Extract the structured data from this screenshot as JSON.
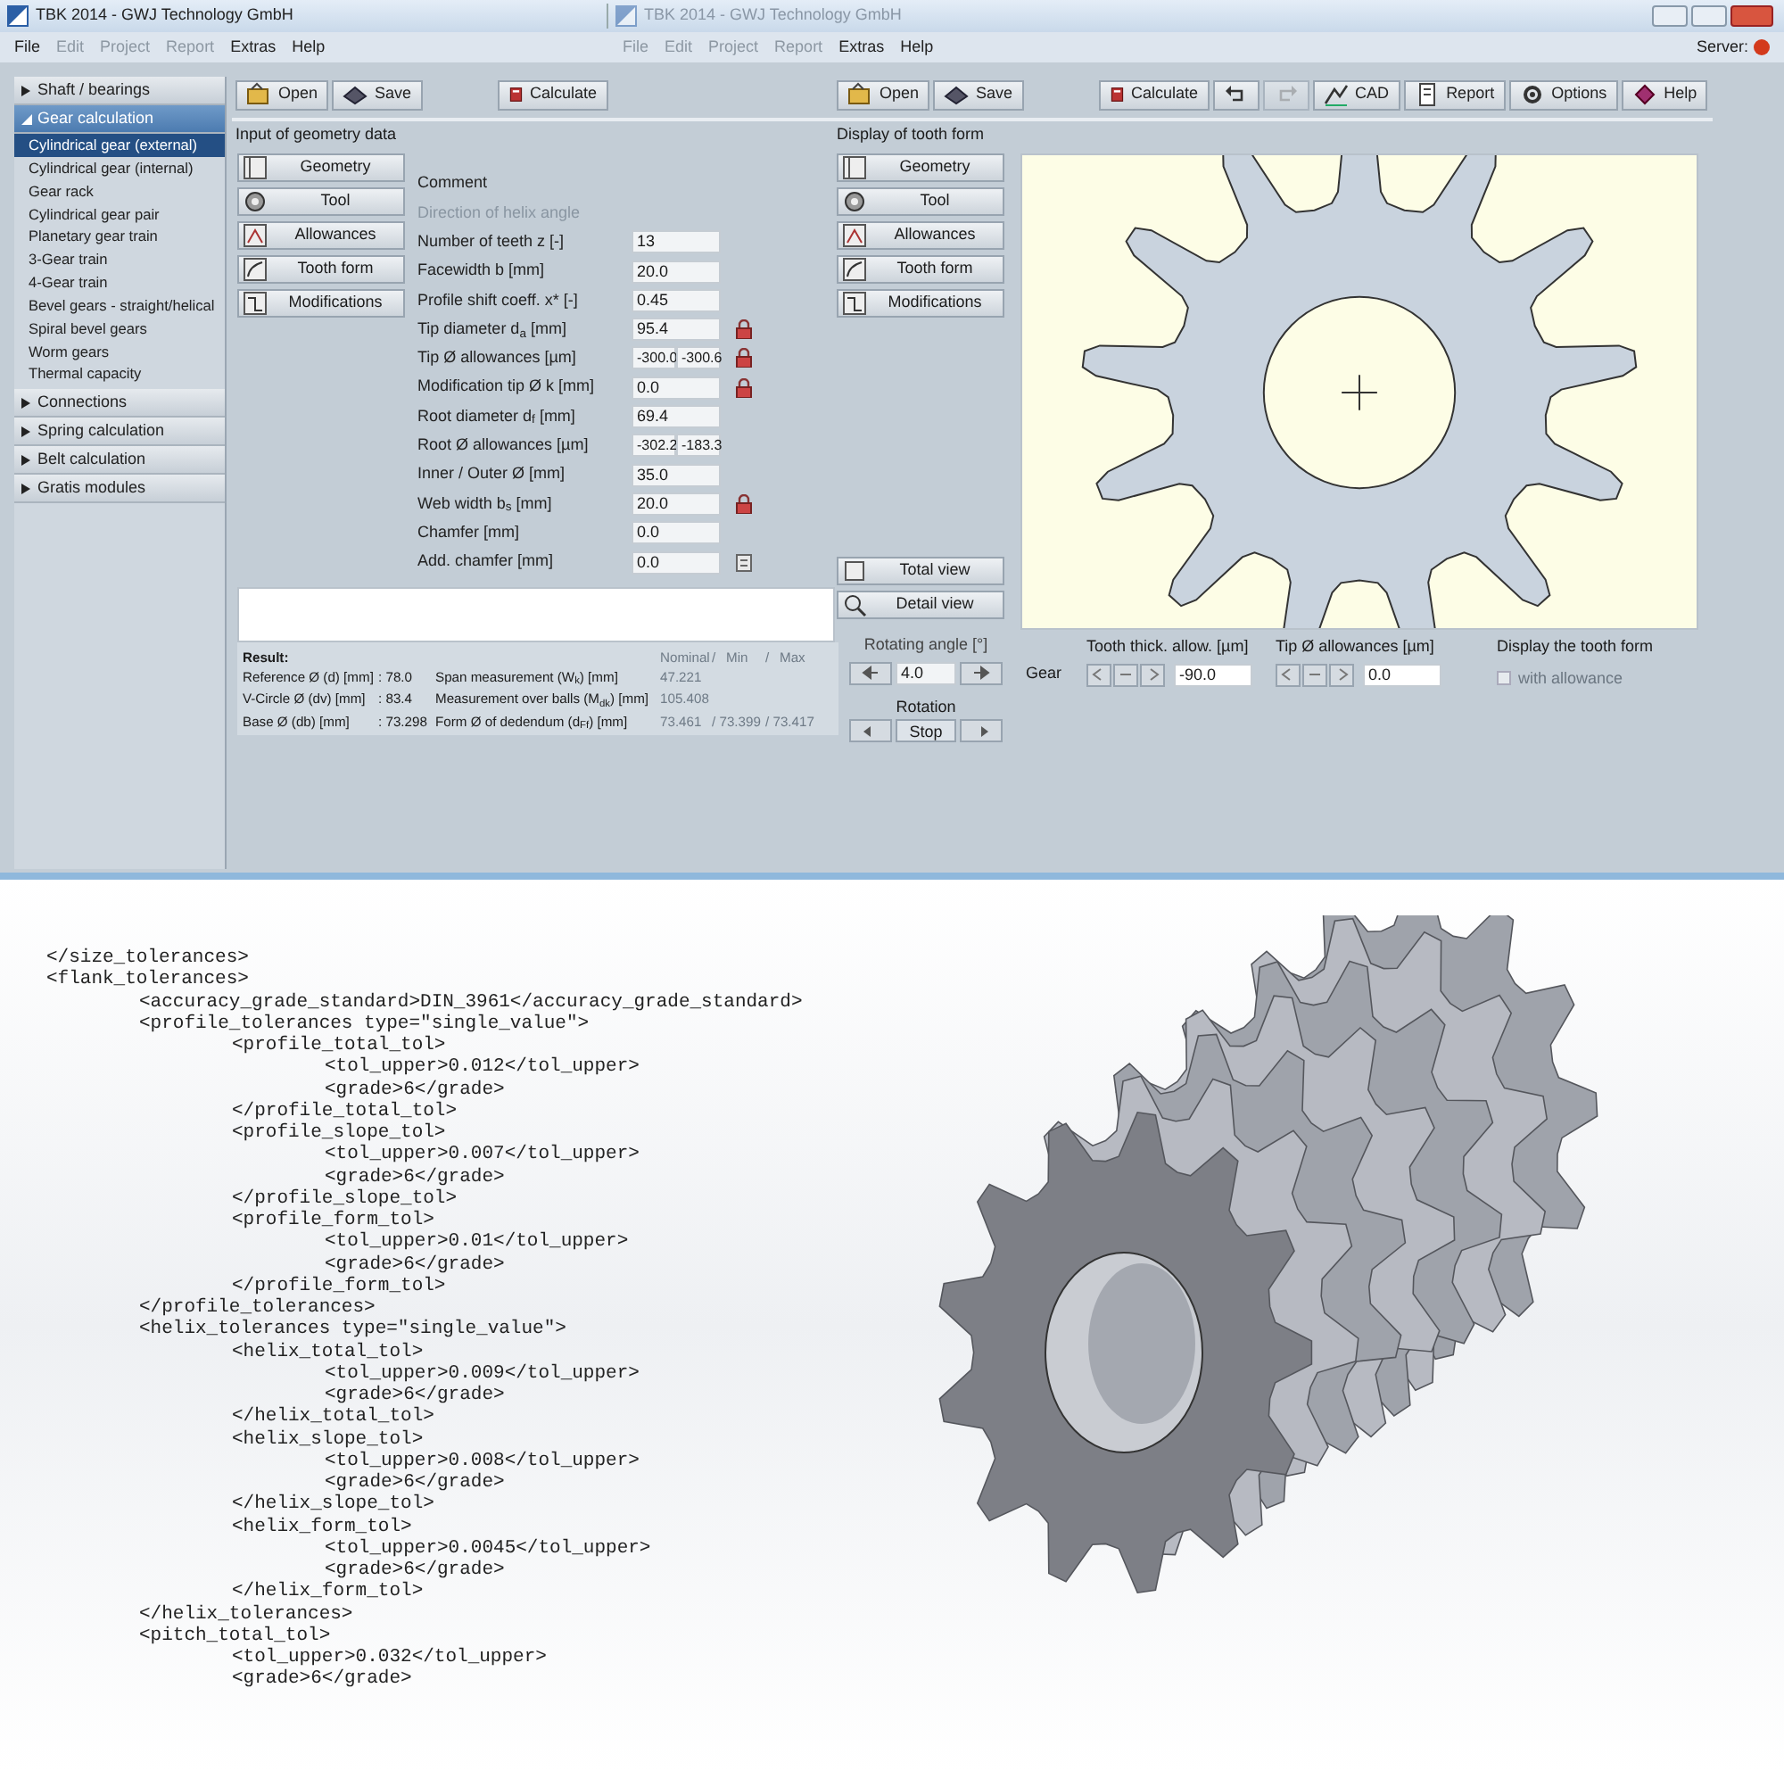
{
  "windows": [
    {
      "title": "TBK 2014 - GWJ Technology GmbH",
      "faded": false
    },
    {
      "title": "TBK 2014 - GWJ Technology GmbH",
      "faded": true
    }
  ],
  "menus": [
    [
      {
        "label": "File",
        "disabled": false
      },
      {
        "label": "Edit",
        "disabled": true
      },
      {
        "label": "Project",
        "disabled": true
      },
      {
        "label": "Report",
        "disabled": true
      },
      {
        "label": "Extras",
        "disabled": false
      },
      {
        "label": "Help",
        "disabled": false
      }
    ],
    [
      {
        "label": "File",
        "disabled": true
      },
      {
        "label": "Edit",
        "disabled": true
      },
      {
        "label": "Project",
        "disabled": true
      },
      {
        "label": "Report",
        "disabled": true
      },
      {
        "label": "Extras",
        "disabled": false
      },
      {
        "label": "Help",
        "disabled": false
      }
    ]
  ],
  "server": {
    "label": "Server:",
    "color": "#d33a1c"
  },
  "sidebar": [
    {
      "label": "Shaft / bearings",
      "expanded": false,
      "selected": false
    },
    {
      "label": "Gear calculation",
      "expanded": true,
      "selected": true,
      "children": [
        {
          "label": "Cylindrical gear (external)",
          "selected": true
        },
        {
          "label": "Cylindrical gear (internal)",
          "selected": false
        },
        {
          "label": "Gear rack",
          "selected": false
        },
        {
          "label": "Cylindrical gear pair",
          "selected": false
        },
        {
          "label": "Planetary gear train",
          "selected": false
        },
        {
          "label": "3-Gear train",
          "selected": false
        },
        {
          "label": "4-Gear train",
          "selected": false
        },
        {
          "label": "Bevel gears - straight/helical",
          "selected": false
        },
        {
          "label": "Spiral bevel gears",
          "selected": false
        },
        {
          "label": "Worm gears",
          "selected": false
        },
        {
          "label": "Thermal capacity",
          "selected": false
        }
      ]
    },
    {
      "label": "Connections",
      "expanded": false,
      "selected": false
    },
    {
      "label": "Spring calculation",
      "expanded": false,
      "selected": false
    },
    {
      "label": "Belt calculation",
      "expanded": false,
      "selected": false
    },
    {
      "label": "Gratis modules",
      "expanded": false,
      "selected": false
    }
  ],
  "toolbar_left": [
    {
      "label": "Open",
      "kind": "open"
    },
    {
      "label": "Save",
      "kind": "save"
    },
    {
      "label": "Calculate",
      "kind": "calculate"
    }
  ],
  "toolbar_right": [
    {
      "label": "Open",
      "kind": "open",
      "disabled": false
    },
    {
      "label": "Save",
      "kind": "save",
      "disabled": false
    },
    {
      "label": "Calculate",
      "kind": "calculate",
      "disabled": false
    },
    {
      "kind": "undo",
      "disabled": false
    },
    {
      "kind": "redo",
      "disabled": true
    },
    {
      "label": "CAD",
      "kind": "cad",
      "disabled": false
    },
    {
      "label": "Report",
      "kind": "report",
      "disabled": false
    },
    {
      "label": "Options",
      "kind": "options",
      "disabled": false
    },
    {
      "label": "Help",
      "kind": "help",
      "disabled": false
    }
  ],
  "input_panel": {
    "title": "Input of geometry data",
    "buttons": [
      {
        "label": "Geometry",
        "kind": "geometry"
      },
      {
        "label": "Tool",
        "kind": "tool"
      },
      {
        "label": "Allowances",
        "kind": "allowances"
      },
      {
        "label": "Tooth form",
        "kind": "toothform"
      },
      {
        "label": "Modifications",
        "kind": "modifications"
      }
    ],
    "fields": [
      {
        "label": "Comment",
        "disabled": false
      },
      {
        "label": "Direction of helix angle",
        "disabled": true
      },
      {
        "label": "Number of teeth z [-]",
        "disabled": false,
        "value": "13"
      },
      {
        "label": "Facewidth b [mm]",
        "disabled": false,
        "value": "20.0"
      },
      {
        "label": "Profile shift coeff. x* [-]",
        "disabled": false,
        "value": "0.45"
      },
      {
        "label": "Tip diameter d$_{a}$ [mm]",
        "disabled": false,
        "value": "95.4",
        "kind": "lock"
      },
      {
        "label": "Tip Ø allowances [µm]",
        "disabled": false,
        "value": "-300.0",
        "value2": "-300.6",
        "kind": "lock"
      },
      {
        "label": "Modification tip Ø k [mm]",
        "disabled": false,
        "value": "0.0",
        "kind": "lock"
      },
      {
        "label": "Root diameter d$_{f}$ [mm]",
        "disabled": false,
        "value": "69.4"
      },
      {
        "label": "Root Ø allowances [µm]",
        "disabled": false,
        "value": "-302.2",
        "value2": "-183.3"
      },
      {
        "label": "Inner / Outer Ø [mm]",
        "disabled": false,
        "value": "35.0"
      },
      {
        "label": "Web width b$_{s}$ [mm]",
        "disabled": false,
        "value": "20.0",
        "kind": "lock"
      },
      {
        "label": "Chamfer [mm]",
        "disabled": false,
        "value": "0.0"
      },
      {
        "label": "Add. chamfer [mm]",
        "disabled": false,
        "value": "0.0",
        "kind": "table"
      }
    ]
  },
  "results": {
    "title": "Result:",
    "header": [
      "Nominal",
      "/",
      "Min",
      "/",
      "Max"
    ],
    "rows": [
      {
        "label": "Reference Ø (d) [mm]",
        "value": ": 78.0",
        "measure": "Span measurement (W$_{k}$) [mm]",
        "nominal": "47.221"
      },
      {
        "label": "V-Circle Ø (dv) [mm]",
        "value": ": 83.4",
        "measure": "Measurement over balls (M$_{dk}$) [mm]",
        "nominal": "105.408"
      },
      {
        "label": "Base Ø (db) [mm]",
        "value": ": 73.298",
        "measure": "Form Ø of dedendum (d$_{Ff}$) [mm]",
        "nominal": "73.461",
        "min": "/ 73.399",
        "max": "/ 73.417"
      }
    ]
  },
  "display_panel": {
    "title": "Display of tooth form",
    "buttons": [
      {
        "label": "Geometry",
        "kind": "geometry"
      },
      {
        "label": "Tool",
        "kind": "tool"
      },
      {
        "label": "Allowances",
        "kind": "allowances"
      },
      {
        "label": "Tooth form",
        "kind": "toothform"
      },
      {
        "label": "Modifications",
        "kind": "modifications"
      }
    ],
    "view_buttons": [
      {
        "label": "Total view",
        "kind": "total"
      },
      {
        "label": "Detail view",
        "kind": "detail"
      }
    ],
    "rotating_angle": {
      "label": "Rotating angle [°]",
      "value": "4.0"
    },
    "gear_label": "Gear",
    "tooth_thick": {
      "label": "Tooth thick. allow. [µm]",
      "value": "-90.0"
    },
    "tip_allow": {
      "label": "Tip Ø allowances [µm]",
      "value": "0.0"
    },
    "display_form": {
      "label": "Display the tooth form",
      "option": "with allowance",
      "checked": false,
      "disabled": true
    },
    "rotation": {
      "label": "Rotation",
      "stop": "Stop"
    }
  },
  "xml": [
    {
      "text": "</size_tolerances>"
    },
    {
      "text": "<flank_tolerances>",
      "children": [
        {
          "text": "<accuracy_grade_standard>DIN_3961</accuracy_grade_standard>"
        },
        {
          "text": "<profile_tolerances type=\"single_value\">",
          "children": [
            {
              "text": "<profile_total_tol>",
              "children": [
                {
                  "text": "<tol_upper>0.012</tol_upper>"
                },
                {
                  "text": "<grade>6</grade>"
                }
              ]
            },
            {
              "text": "</profile_total_tol>"
            },
            {
              "text": "<profile_slope_tol>",
              "children": [
                {
                  "text": "<tol_upper>0.007</tol_upper>"
                },
                {
                  "text": "<grade>6</grade>"
                }
              ]
            },
            {
              "text": "</profile_slope_tol>"
            },
            {
              "text": "<profile_form_tol>",
              "children": [
                {
                  "text": "<tol_upper>0.01</tol_upper>"
                },
                {
                  "text": "<grade>6</grade>"
                }
              ]
            },
            {
              "text": "</profile_form_tol>"
            }
          ]
        },
        {
          "text": "</profile_tolerances>"
        },
        {
          "text": "<helix_tolerances type=\"single_value\">",
          "children": [
            {
              "text": "<helix_total_tol>",
              "children": [
                {
                  "text": "<tol_upper>0.009</tol_upper>"
                },
                {
                  "text": "<grade>6</grade>"
                }
              ]
            },
            {
              "text": "</helix_total_tol>"
            },
            {
              "text": "<helix_slope_tol>",
              "children": [
                {
                  "text": "<tol_upper>0.008</tol_upper>"
                },
                {
                  "text": "<grade>6</grade>"
                }
              ]
            },
            {
              "text": "</helix_slope_tol>"
            },
            {
              "text": "<helix_form_tol>",
              "children": [
                {
                  "text": "<tol_upper>0.0045</tol_upper>"
                },
                {
                  "text": "<grade>6</grade>"
                }
              ]
            },
            {
              "text": "</helix_form_tol>"
            }
          ]
        },
        {
          "text": "</helix_tolerances>"
        },
        {
          "text": "<pitch_total_tol>",
          "children": [
            {
              "text": "<tol_upper>0.032</tol_upper>"
            },
            {
              "text": "<grade>6</grade>"
            }
          ]
        }
      ]
    }
  ]
}
